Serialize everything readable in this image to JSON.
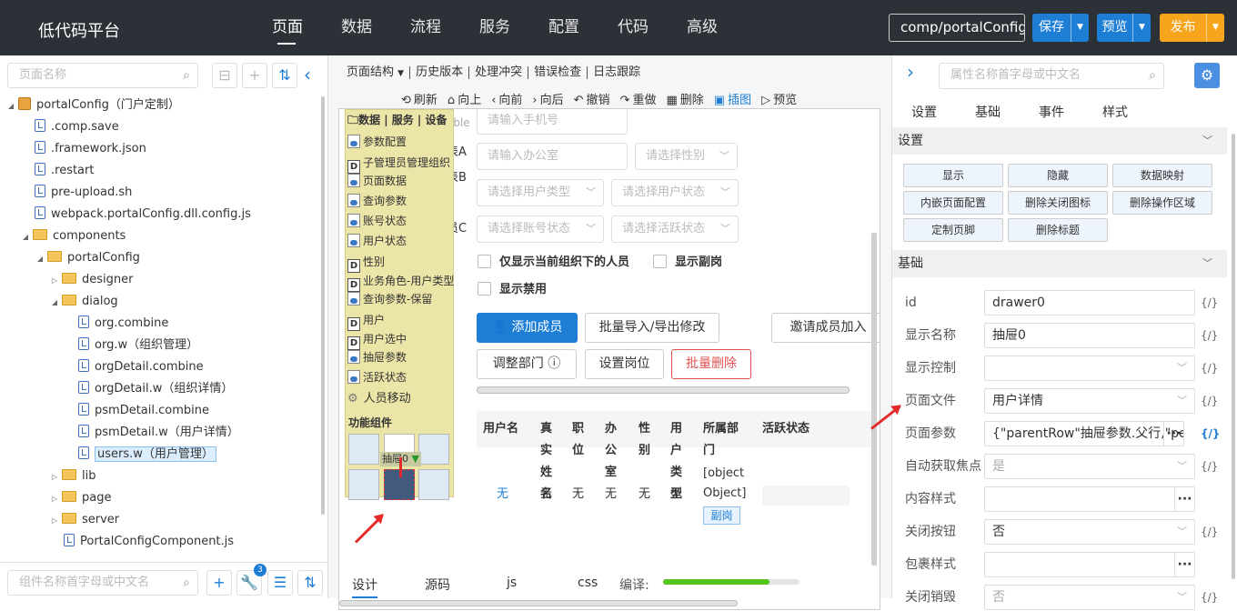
{
  "app": {
    "title": "低代码平台"
  },
  "nav": [
    "页面",
    "数据",
    "流程",
    "服务",
    "配置",
    "代码",
    "高级"
  ],
  "top": {
    "component": "comp/portalConfig",
    "save": "保存",
    "preview": "预览",
    "publish": "发布"
  },
  "left": {
    "search_placeholder": "页面名称",
    "bottom_search_placeholder": "组件名称首字母或中文名",
    "badge": "3",
    "tree": [
      {
        "label": "portalConfig（门户定制）",
        "type": "pkg"
      },
      {
        "label": ".comp.save",
        "type": "file"
      },
      {
        "label": ".framework.json",
        "type": "file"
      },
      {
        "label": ".restart",
        "type": "file"
      },
      {
        "label": "pre-upload.sh",
        "type": "file"
      },
      {
        "label": "webpack.portalConfig.dll.config.js",
        "type": "file"
      },
      {
        "label": "components",
        "type": "folder"
      },
      {
        "label": "portalConfig",
        "type": "folder"
      },
      {
        "label": "designer",
        "type": "folder"
      },
      {
        "label": "dialog",
        "type": "folder"
      },
      {
        "label": "org.combine",
        "type": "file"
      },
      {
        "label": "org.w（组织管理）",
        "type": "file"
      },
      {
        "label": "orgDetail.combine",
        "type": "file"
      },
      {
        "label": "orgDetail.w（组织详情）",
        "type": "file"
      },
      {
        "label": "psmDetail.combine",
        "type": "file"
      },
      {
        "label": "psmDetail.w（用户详情）",
        "type": "file"
      },
      {
        "label": "users.w（用户管理）",
        "type": "file"
      },
      {
        "label": "lib",
        "type": "folder"
      },
      {
        "label": "page",
        "type": "folder"
      },
      {
        "label": "server",
        "type": "folder"
      },
      {
        "label": "PortalConfigComponent.js",
        "type": "file"
      }
    ]
  },
  "middle": {
    "tabs": [
      "页面结构",
      "历史版本",
      "处理冲突",
      "错误检查",
      "日志跟踪"
    ],
    "toolbar": [
      {
        "icon": "⟲",
        "label": "刷新"
      },
      {
        "icon": "⌂",
        "label": "向上"
      },
      {
        "icon": "‹",
        "label": "向前"
      },
      {
        "icon": "›",
        "label": "向后"
      },
      {
        "icon": "↶",
        "label": "撤销"
      },
      {
        "icon": "↷",
        "label": "重做"
      },
      {
        "icon": "▦",
        "label": "删除"
      },
      {
        "icon": "▣",
        "label": "插图"
      },
      {
        "icon": "▷",
        "label": "预览"
      }
    ],
    "form": {
      "phone_placeholder": "请输入手机号",
      "office_placeholder": "请输入办公室",
      "gender_placeholder": "请选择性别",
      "usertype_placeholder": "请选择用户类型",
      "userstatus_placeholder": "请选择用户状态",
      "acctstatus_placeholder": "请选择账号状态",
      "activestatus_placeholder": "请选择活跃状态",
      "cb_current_org": "仅显示当前组织下的人员",
      "cb_show_deputy": "显示副岗",
      "cb_show_disabled": "显示禁用",
      "frag_table": "able",
      "frag_a": "表A",
      "frag_b": "表B",
      "frag_c": "员C"
    },
    "buttons": {
      "add_member": "添加成员",
      "batch_import": "批量导入/导出修改",
      "invite": "邀请成员加入",
      "adjust_dept": "调整部门",
      "set_post": "设置岗位",
      "batch_delete": "批量删除"
    },
    "table": {
      "headers": [
        "用户名",
        "真实姓名",
        "职位",
        "办公室",
        "性别",
        "用户类型",
        "所属部门",
        "活跃状态"
      ],
      "row": [
        "无",
        "无",
        "无",
        "无",
        "无",
        "无",
        "[object Object]"
      ],
      "tag": "副岗"
    },
    "palette": {
      "header": "数据 | 服务 | 设备",
      "items": [
        {
          "label": "参数配置",
          "icon": "db"
        },
        {
          "label": "子管理员管理组织",
          "icon": "D"
        },
        {
          "label": "页面数据",
          "icon": "db"
        },
        {
          "label": "查询参数",
          "icon": "db"
        },
        {
          "label": "账号状态",
          "icon": "db"
        },
        {
          "label": "用户状态",
          "icon": "db"
        },
        {
          "label": "性别",
          "icon": "D"
        },
        {
          "label": "业务角色-用户类型",
          "icon": "D"
        },
        {
          "label": "查询参数-保留",
          "icon": "db"
        },
        {
          "label": "用户",
          "icon": "D"
        },
        {
          "label": "用户选中",
          "icon": "D"
        },
        {
          "label": "抽屉参数",
          "icon": "db"
        },
        {
          "label": "活跃状态",
          "icon": "db"
        },
        {
          "label": "人员移动",
          "icon": "gear"
        }
      ],
      "section2": "功能组件",
      "drawer_tag": "抽屉0"
    },
    "bottom_tabs": [
      "设计",
      "源码",
      "js",
      "css"
    ],
    "compile_label": "编译:",
    "compile_progress": 0.78
  },
  "right": {
    "search_placeholder": "属性名称首字母或中文名",
    "tabs": [
      "设置",
      "基础",
      "事件",
      "样式"
    ],
    "section_settings": "设置",
    "section_basic": "基础",
    "setting_buttons": [
      "显示",
      "隐藏",
      "数据映射",
      "内嵌页面配置",
      "删除关闭图标",
      "删除操作区域",
      "定制页脚",
      "删除标题"
    ],
    "props": [
      {
        "label": "id",
        "value": "drawer0",
        "kind": "text",
        "fx": "{/}"
      },
      {
        "label": "显示名称",
        "value": "抽屉0",
        "kind": "text",
        "fx": "{/}"
      },
      {
        "label": "显示控制",
        "value": "",
        "kind": "select",
        "fx": "{/}"
      },
      {
        "label": "页面文件",
        "value": "用户详情",
        "kind": "select",
        "fx": "{/}"
      },
      {
        "label": "页面参数",
        "value": "{\"parentRow\"抽屉参数.父行,\"pe",
        "kind": "more",
        "fx": "{/}"
      },
      {
        "label": "自动获取焦点",
        "value": "是",
        "kind": "select-ph",
        "fx": "{/}"
      },
      {
        "label": "内容样式",
        "value": "",
        "kind": "more",
        "fx": ""
      },
      {
        "label": "关闭按钮",
        "value": "否",
        "kind": "select",
        "fx": "{/}"
      },
      {
        "label": "包裹样式",
        "value": "",
        "kind": "more",
        "fx": ""
      },
      {
        "label": "关闭销毁",
        "value": "否",
        "kind": "select-ph",
        "fx": "{/}"
      }
    ]
  },
  "colors": {
    "topbar": "#2b3137",
    "primary": "#1e7ed6",
    "publish": "#f7a51c",
    "danger": "#e05252",
    "palette": "#ece5a8",
    "progress": "#52c41a"
  }
}
